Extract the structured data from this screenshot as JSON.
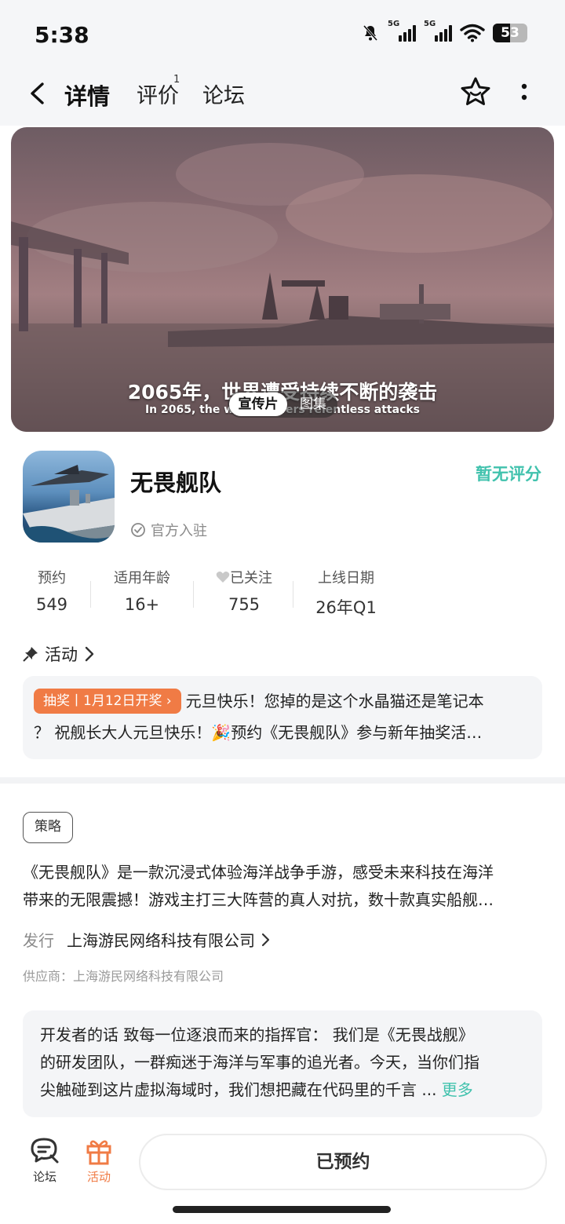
{
  "status_bar": {
    "time": "5:38",
    "network_1": "5G",
    "network_2": "5G",
    "battery": "53"
  },
  "nav": {
    "tabs": [
      {
        "label": "详情",
        "active": true
      },
      {
        "label": "评价",
        "badge": "1"
      },
      {
        "label": "论坛"
      }
    ],
    "icons": [
      "back-icon",
      "star-icon",
      "more-icon"
    ]
  },
  "media": {
    "subtitle_zh": "2065年，世界遭受持续不断的袭击",
    "subtitle_en": "In 2065, the world suffers relentless attacks",
    "toggle_active": "宣传片",
    "toggle_inactive": "图集"
  },
  "app": {
    "name": "无畏舰队",
    "rating": "暂无评分",
    "official": "官方入驻"
  },
  "stats": [
    {
      "label": "预约",
      "value": "549"
    },
    {
      "label": "适用年龄",
      "value": "16+"
    },
    {
      "label": "已关注",
      "value": "755"
    },
    {
      "label": "上线日期",
      "value": "26年Q1"
    }
  ],
  "activity": {
    "title": "活动",
    "badge": "抽奖丨1月12日开奖 ›",
    "text_1": "元旦快乐！您掉的是这个水晶猫还是笔记本",
    "text_2": "？ 祝舰长大人元旦快乐！🎉预约《无畏舰队》参与新年抽奖活…"
  },
  "info": {
    "tag": "策略",
    "desc_1": "《无畏舰队》是一款沉浸式体验海洋战争手游，感受未来科技在海洋",
    "desc_2": "带来的无限震撼！游戏主打三大阵营的真人对抗，数十款真实船舰…",
    "publisher_key": "发行",
    "publisher": "上海游民网络科技有限公司",
    "supplier": "供应商：上海游民网络科技有限公司"
  },
  "developer": {
    "line_1": "开发者的话  致每一位逐浪而来的指挥官：  我们是《无畏战舰》",
    "line_2": "的研发团队，一群痴迷于海洋与军事的追光者。今天，当你们指",
    "line_3": "尖触碰到这片虚拟海域时，我们想把藏在代码里的千言 ... ",
    "more": "更多"
  },
  "bottom_bar": {
    "forum": "论坛",
    "activity": "活动",
    "reserve": "已预约"
  },
  "colors": {
    "accent": "#41c2ad",
    "tab_highlight": "#54d8c4",
    "lottery": "#f07b45",
    "activity_icon": "#f07b45"
  }
}
